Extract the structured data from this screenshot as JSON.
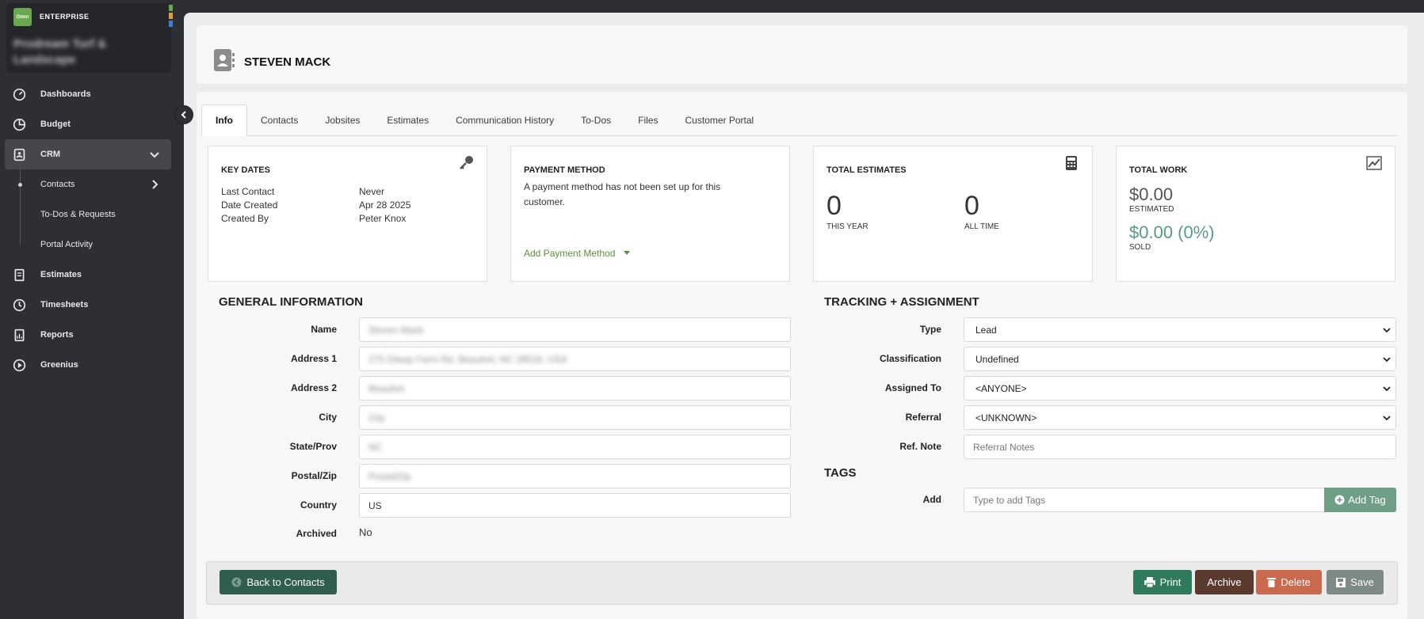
{
  "brand": {
    "logo_text": "Gtmn",
    "edition": "ENTERPRISE",
    "company": "Prodream Turf & Landscape",
    "stripe_colors": [
      "#6aa84f",
      "#d4a33b",
      "#3b7dd8"
    ]
  },
  "nav": {
    "dashboards": "Dashboards",
    "budget": "Budget",
    "crm": "CRM",
    "contacts": "Contacts",
    "todos": "To-Dos & Requests",
    "portal": "Portal Activity",
    "estimates": "Estimates",
    "timesheets": "Timesheets",
    "reports": "Reports",
    "greenius": "Greenius"
  },
  "header": {
    "name": "STEVEN MACK"
  },
  "tabs": [
    "Info",
    "Contacts",
    "Jobsites",
    "Estimates",
    "Communication History",
    "To-Dos",
    "Files",
    "Customer Portal"
  ],
  "key_dates": {
    "title": "KEY DATES",
    "rows": [
      {
        "label": "Last Contact",
        "value": "Never"
      },
      {
        "label": "Date Created",
        "value": "Apr 28 2025"
      },
      {
        "label": "Created By",
        "value": "Peter Knox"
      }
    ]
  },
  "payment": {
    "title": "PAYMENT METHOD",
    "text": "A payment method has not been set up for this customer.",
    "link": "Add Payment Method"
  },
  "total_estimates": {
    "title": "TOTAL ESTIMATES",
    "this_year": "0",
    "this_year_label": "THIS YEAR",
    "all_time": "0",
    "all_time_label": "ALL TIME"
  },
  "total_work": {
    "title": "TOTAL WORK",
    "estimated": "$0.00",
    "estimated_label": "ESTIMATED",
    "sold": "$0.00 (0%)",
    "sold_label": "SOLD",
    "sold_color": "#5a9a80"
  },
  "general": {
    "title": "GENERAL INFORMATION",
    "name_label": "Name",
    "name_value": "Steven Mack",
    "address1_label": "Address 1",
    "address1_value": "275 Olway Farm Rd, Beaufort, NC 28516, USA",
    "address2_label": "Address 2",
    "address2_value": "Beaufort",
    "city_label": "City",
    "city_value": "City",
    "state_label": "State/Prov",
    "state_value": "NC",
    "postal_label": "Postal/Zip",
    "postal_value": "Postal/Zip",
    "country_label": "Country",
    "country_value": "US",
    "archived_label": "Archived",
    "archived_value": "No"
  },
  "tracking": {
    "title": "TRACKING + ASSIGNMENT",
    "type_label": "Type",
    "type_value": "Lead",
    "class_label": "Classification",
    "class_value": "Undefined",
    "assigned_label": "Assigned To",
    "assigned_value": "<ANYONE>",
    "referral_label": "Referral",
    "referral_value": "<UNKNOWN>",
    "refnote_label": "Ref. Note",
    "refnote_placeholder": "Referral Notes"
  },
  "tags": {
    "title": "TAGS",
    "add_label": "Add",
    "placeholder": "Type to add Tags",
    "button": "Add Tag"
  },
  "footer": {
    "back": "Back to Contacts",
    "print": "Print",
    "archive": "Archive",
    "delete": "Delete",
    "save": "Save",
    "colors": {
      "back": "#2f5e4e",
      "print": "#2e7a5b",
      "archive": "#5a3a2e",
      "delete": "#c9694e",
      "save": "#7d8a86"
    }
  }
}
